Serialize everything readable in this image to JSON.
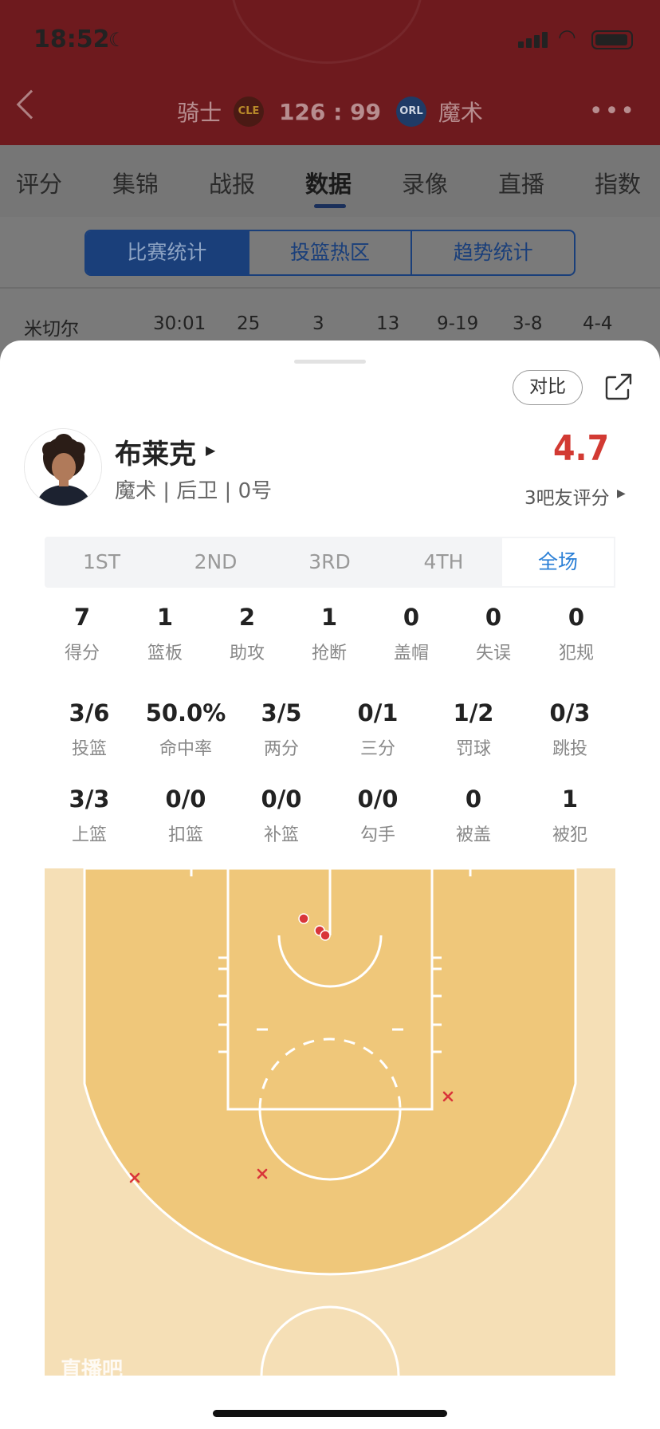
{
  "status_bar": {
    "time": "18:52"
  },
  "match_header": {
    "home_team": "骑士",
    "home_logo": "CLE",
    "score": "126 : 99",
    "away_team": "魔术",
    "away_logo": "ORL"
  },
  "nav_tabs": [
    "评分",
    "集锦",
    "战报",
    "数据",
    "录像",
    "直播",
    "指数"
  ],
  "nav_active": "数据",
  "segments": [
    "比赛统计",
    "投篮热区",
    "趋势统计"
  ],
  "background_row": {
    "name": "米切尔",
    "cells": [
      "30:01",
      "25",
      "3",
      "13",
      "9-19",
      "3-8",
      "4-4"
    ]
  },
  "sheet": {
    "compare_label": "对比",
    "player": {
      "name": "布莱克",
      "meta": "魔术 | 后卫 | 0号"
    },
    "rating": {
      "score": "4.7",
      "count_label": "3吧友评分"
    },
    "periods": [
      "1ST",
      "2ND",
      "3RD",
      "4TH",
      "全场"
    ],
    "active_period": "全场",
    "stats_row1": [
      {
        "value": "7",
        "label": "得分"
      },
      {
        "value": "1",
        "label": "篮板"
      },
      {
        "value": "2",
        "label": "助攻"
      },
      {
        "value": "1",
        "label": "抢断"
      },
      {
        "value": "0",
        "label": "盖帽"
      },
      {
        "value": "0",
        "label": "失误"
      },
      {
        "value": "0",
        "label": "犯规"
      }
    ],
    "stats_row2": [
      {
        "value": "3/6",
        "label": "投篮"
      },
      {
        "value": "50.0%",
        "label": "命中率"
      },
      {
        "value": "3/5",
        "label": "两分"
      },
      {
        "value": "0/1",
        "label": "三分"
      },
      {
        "value": "1/2",
        "label": "罚球"
      },
      {
        "value": "0/3",
        "label": "跳投"
      }
    ],
    "stats_row3": [
      {
        "value": "3/3",
        "label": "上篮"
      },
      {
        "value": "0/0",
        "label": "扣篮"
      },
      {
        "value": "0/0",
        "label": "补篮"
      },
      {
        "value": "0/0",
        "label": "勾手"
      },
      {
        "value": "0",
        "label": "被盖"
      },
      {
        "value": "1",
        "label": "被犯"
      }
    ],
    "shot_chart": {
      "made_color": "#d9353a",
      "missed_color": "#d9353a",
      "made": 3,
      "missed": 3,
      "watermark": "直播吧"
    }
  }
}
